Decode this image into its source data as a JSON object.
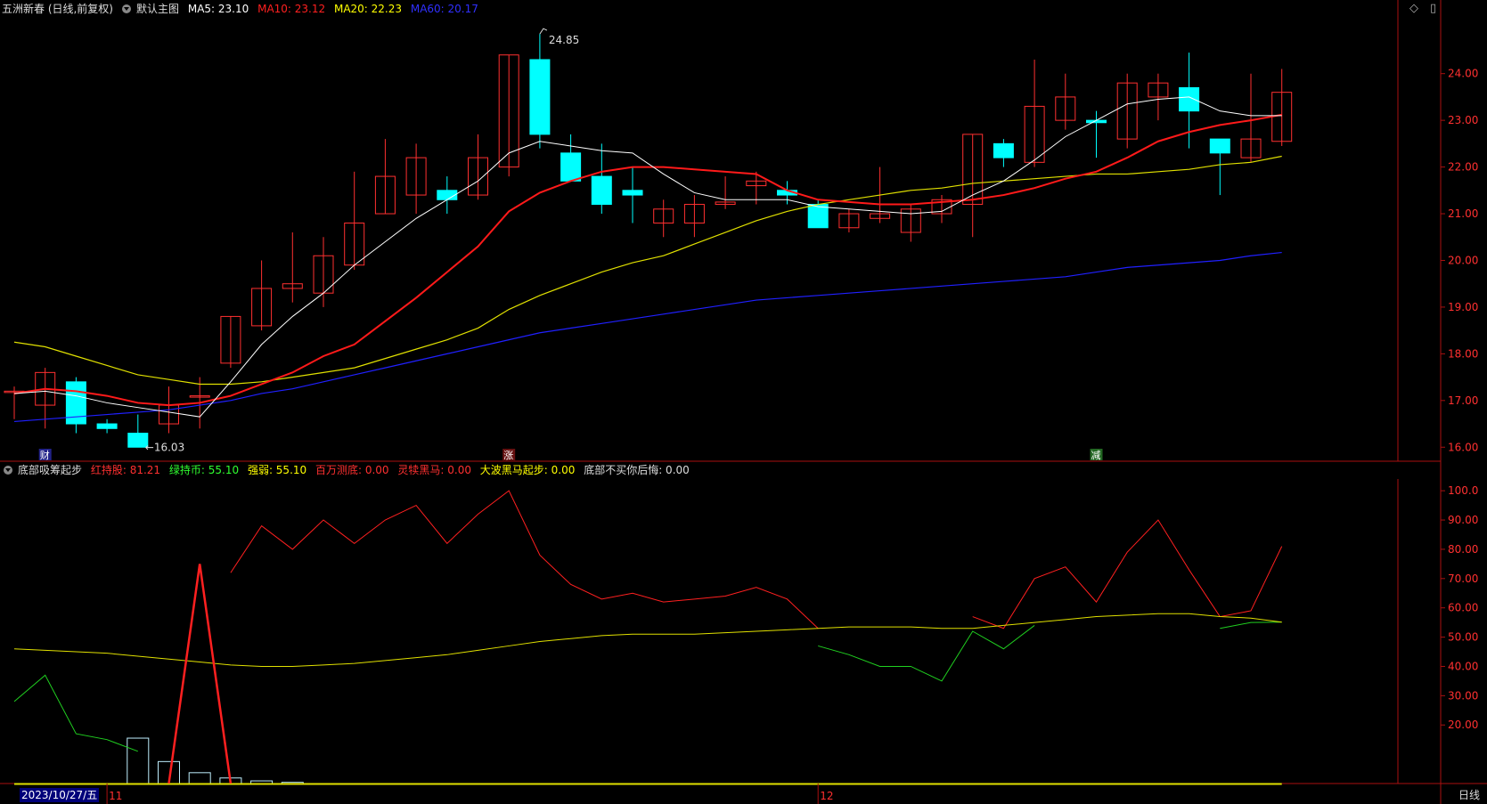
{
  "header": {
    "stock_title": "五洲新春 (日线,前复权)",
    "main_indicator": "默认主图",
    "ma": [
      {
        "label": "MA5: 23.10",
        "color": "#ffffff"
      },
      {
        "label": "MA10: 23.12",
        "color": "#ff2020"
      },
      {
        "label": "MA20: 22.23",
        "color": "#ffff00"
      },
      {
        "label": "MA60: 20.17",
        "color": "#2020ff"
      }
    ],
    "controls": [
      "◇",
      "▯"
    ]
  },
  "sub_header": {
    "indicator_name": "底部吸筹起步",
    "values": [
      {
        "label": "红持股: 81.21",
        "color": "#ff3030"
      },
      {
        "label": "绿持币: 55.10",
        "color": "#30ff30"
      },
      {
        "label": "强弱: 55.10",
        "color": "#ffff00"
      },
      {
        "label": "百万测底: 0.00",
        "color": "#ff3030"
      },
      {
        "label": "灵犊黑马: 0.00",
        "color": "#ff3030"
      },
      {
        "label": "大波黑马起步: 0.00",
        "color": "#ffff00"
      },
      {
        "label": "底部不买你后悔: 0.00",
        "color": "#dddddd"
      }
    ]
  },
  "colors": {
    "up": "#ff3030",
    "down": "#00ffff",
    "ma5": "#ffffff",
    "ma10": "#ff1a1a",
    "ma20": "#e0e000",
    "ma60": "#2020ff",
    "axis": "#aa1010",
    "label": "#ff3030"
  },
  "chart_data": [
    {
      "type": "candlestick",
      "y_ticks": [
        "24.00",
        "23.00",
        "22.00",
        "21.00",
        "20.00",
        "19.00",
        "18.00",
        "17.00",
        "16.00"
      ],
      "ylim": [
        15.7,
        25.1
      ],
      "candles": [
        {
          "o": 17.2,
          "h": 17.3,
          "l": 16.6,
          "c": 17.2
        },
        {
          "o": 16.9,
          "h": 17.7,
          "l": 16.4,
          "c": 17.6
        },
        {
          "o": 17.4,
          "h": 17.5,
          "l": 16.3,
          "c": 16.5
        },
        {
          "o": 16.5,
          "h": 16.6,
          "l": 16.3,
          "c": 16.4
        },
        {
          "o": 16.3,
          "h": 16.7,
          "l": 16.0,
          "c": 16.0
        },
        {
          "o": 16.5,
          "h": 17.3,
          "l": 16.3,
          "c": 16.9
        },
        {
          "o": 17.1,
          "h": 17.5,
          "l": 16.4,
          "c": 17.1
        },
        {
          "o": 17.8,
          "h": 18.8,
          "l": 17.7,
          "c": 18.8
        },
        {
          "o": 18.6,
          "h": 20.0,
          "l": 18.5,
          "c": 19.4
        },
        {
          "o": 19.4,
          "h": 20.6,
          "l": 19.1,
          "c": 19.5
        },
        {
          "o": 19.3,
          "h": 20.5,
          "l": 19.0,
          "c": 20.1
        },
        {
          "o": 19.9,
          "h": 21.9,
          "l": 19.8,
          "c": 20.8
        },
        {
          "o": 21.0,
          "h": 22.6,
          "l": 21.0,
          "c": 21.8
        },
        {
          "o": 21.4,
          "h": 22.5,
          "l": 21.0,
          "c": 22.2
        },
        {
          "o": 21.5,
          "h": 21.8,
          "l": 21.0,
          "c": 21.3
        },
        {
          "o": 21.4,
          "h": 22.7,
          "l": 21.3,
          "c": 22.2
        },
        {
          "o": 22.0,
          "h": 24.4,
          "l": 21.8,
          "c": 24.4
        },
        {
          "o": 24.3,
          "h": 24.85,
          "l": 22.4,
          "c": 22.7
        },
        {
          "o": 22.3,
          "h": 22.7,
          "l": 21.7,
          "c": 21.7
        },
        {
          "o": 21.8,
          "h": 22.5,
          "l": 21.0,
          "c": 21.2
        },
        {
          "o": 21.5,
          "h": 22.0,
          "l": 20.8,
          "c": 21.4
        },
        {
          "o": 20.8,
          "h": 21.3,
          "l": 20.5,
          "c": 21.1
        },
        {
          "o": 20.8,
          "h": 21.4,
          "l": 20.5,
          "c": 21.2
        },
        {
          "o": 21.2,
          "h": 21.8,
          "l": 21.1,
          "c": 21.25
        },
        {
          "o": 21.6,
          "h": 21.9,
          "l": 21.2,
          "c": 21.7
        },
        {
          "o": 21.5,
          "h": 21.7,
          "l": 21.2,
          "c": 21.4
        },
        {
          "o": 21.2,
          "h": 21.3,
          "l": 20.7,
          "c": 20.7
        },
        {
          "o": 20.7,
          "h": 21.1,
          "l": 20.6,
          "c": 21.0
        },
        {
          "o": 20.9,
          "h": 22.0,
          "l": 20.8,
          "c": 21.0
        },
        {
          "o": 20.6,
          "h": 21.2,
          "l": 20.4,
          "c": 21.1
        },
        {
          "o": 21.0,
          "h": 21.4,
          "l": 20.8,
          "c": 21.3
        },
        {
          "o": 21.2,
          "h": 22.7,
          "l": 20.5,
          "c": 22.7
        },
        {
          "o": 22.5,
          "h": 22.6,
          "l": 22.0,
          "c": 22.2
        },
        {
          "o": 22.1,
          "h": 24.3,
          "l": 22.0,
          "c": 23.3
        },
        {
          "o": 23.0,
          "h": 24.0,
          "l": 22.8,
          "c": 23.5
        },
        {
          "o": 23.0,
          "h": 23.2,
          "l": 22.2,
          "c": 22.95
        },
        {
          "o": 22.6,
          "h": 24.0,
          "l": 22.4,
          "c": 23.8
        },
        {
          "o": 23.5,
          "h": 24.0,
          "l": 23.0,
          "c": 23.8
        },
        {
          "o": 23.7,
          "h": 24.45,
          "l": 22.4,
          "c": 23.2
        },
        {
          "o": 22.6,
          "h": 22.6,
          "l": 21.4,
          "c": 22.3
        },
        {
          "o": 22.2,
          "h": 24.0,
          "l": 22.1,
          "c": 22.6
        },
        {
          "o": 22.55,
          "h": 24.1,
          "l": 22.45,
          "c": 23.6
        }
      ],
      "ma5": [
        17.15,
        17.2,
        17.1,
        16.95,
        16.85,
        16.75,
        16.65,
        17.4,
        18.2,
        18.8,
        19.3,
        19.9,
        20.4,
        20.9,
        21.3,
        21.7,
        22.3,
        22.55,
        22.45,
        22.35,
        22.3,
        21.85,
        21.45,
        21.3,
        21.3,
        21.3,
        21.15,
        21.1,
        21.05,
        21.0,
        21.05,
        21.4,
        21.7,
        22.15,
        22.65,
        23.0,
        23.35,
        23.45,
        23.5,
        23.2,
        23.1,
        23.1
      ],
      "ma10": [
        17.15,
        17.25,
        17.2,
        17.1,
        16.95,
        16.9,
        16.95,
        17.1,
        17.35,
        17.6,
        17.95,
        18.2,
        18.7,
        19.2,
        19.75,
        20.3,
        21.05,
        21.45,
        21.7,
        21.9,
        22.0,
        22.0,
        21.95,
        21.9,
        21.85,
        21.5,
        21.3,
        21.25,
        21.2,
        21.2,
        21.25,
        21.3,
        21.4,
        21.55,
        21.75,
        21.9,
        22.2,
        22.55,
        22.75,
        22.9,
        23.0,
        23.12
      ],
      "ma20": [
        18.25,
        18.15,
        17.95,
        17.75,
        17.55,
        17.45,
        17.35,
        17.35,
        17.4,
        17.5,
        17.6,
        17.7,
        17.9,
        18.1,
        18.3,
        18.55,
        18.95,
        19.25,
        19.5,
        19.75,
        19.95,
        20.1,
        20.35,
        20.6,
        20.85,
        21.05,
        21.2,
        21.3,
        21.4,
        21.5,
        21.55,
        21.65,
        21.7,
        21.75,
        21.8,
        21.85,
        21.85,
        21.9,
        21.95,
        22.05,
        22.1,
        22.23
      ],
      "ma60": [
        16.55,
        16.6,
        16.65,
        16.7,
        16.75,
        16.8,
        16.9,
        17.0,
        17.15,
        17.25,
        17.4,
        17.55,
        17.7,
        17.85,
        18.0,
        18.15,
        18.3,
        18.45,
        18.55,
        18.65,
        18.75,
        18.85,
        18.95,
        19.05,
        19.15,
        19.2,
        19.25,
        19.3,
        19.35,
        19.4,
        19.45,
        19.5,
        19.55,
        19.6,
        19.65,
        19.75,
        19.85,
        19.9,
        19.95,
        20.0,
        20.1,
        20.17
      ],
      "annotations": [
        {
          "label": "24.85",
          "index": 17,
          "value": 24.85,
          "kind": "high"
        },
        {
          "label": "←16.03",
          "index": 4,
          "value": 16.03,
          "kind": "low"
        }
      ],
      "markers": [
        {
          "text": "财",
          "index": 1,
          "bg": "#222288"
        },
        {
          "text": "涨",
          "index": 16,
          "bg": "#661111"
        },
        {
          "text": "减",
          "index": 35,
          "bg": "#226622"
        }
      ]
    },
    {
      "type": "line",
      "y_ticks": [
        "100.0",
        "90.00",
        "80.00",
        "70.00",
        "60.00",
        "50.00",
        "40.00",
        "30.00",
        "20.00"
      ],
      "ylim": [
        0,
        104
      ],
      "series": [
        {
          "name": "红持股",
          "color": "#ff2020",
          "values": [
            null,
            null,
            null,
            null,
            null,
            null,
            null,
            72,
            88,
            80,
            90,
            82,
            90,
            95,
            82,
            92,
            100,
            78,
            68,
            63,
            65,
            62,
            63,
            64,
            67,
            63,
            53,
            null,
            null,
            null,
            null,
            57,
            53,
            70,
            74,
            62,
            79,
            90,
            73,
            57,
            59,
            81
          ]
        },
        {
          "name": "绿持币",
          "color": "#20d020",
          "values": [
            28,
            37,
            17,
            15,
            11,
            null,
            null,
            null,
            null,
            null,
            null,
            null,
            null,
            null,
            null,
            null,
            null,
            null,
            null,
            null,
            null,
            null,
            null,
            null,
            null,
            null,
            47,
            44,
            40,
            40,
            35,
            52,
            46,
            54,
            null,
            null,
            null,
            null,
            null,
            53,
            55,
            55.1
          ]
        },
        {
          "name": "强弱",
          "color": "#e0e000",
          "values": [
            46,
            45.5,
            45,
            44.5,
            43.5,
            42.5,
            41.5,
            40.5,
            40,
            40,
            40.5,
            41,
            42,
            43,
            44,
            45.5,
            47,
            48.5,
            49.5,
            50.5,
            51,
            51,
            51,
            51.5,
            52,
            52.5,
            53,
            53.5,
            53.5,
            53.5,
            53,
            53,
            54,
            55,
            56,
            57,
            57.5,
            58,
            58,
            57,
            56.5,
            55.1
          ]
        },
        {
          "name": "百万测底",
          "color": "#ff2020",
          "values": [
            0,
            0,
            0,
            0,
            0,
            0,
            75,
            0,
            0,
            0,
            0,
            0,
            0,
            0,
            0,
            0,
            0,
            0,
            0,
            0,
            0,
            0,
            0,
            0,
            0,
            0,
            0,
            0,
            0,
            0,
            0,
            0,
            0,
            0,
            0,
            0,
            0,
            0,
            0,
            0,
            0,
            0
          ]
        }
      ],
      "bars": [
        0,
        0,
        0,
        0,
        15.5,
        7.5,
        3.7,
        1.9,
        0.9,
        0.4,
        0,
        0,
        0,
        0,
        0,
        0,
        0,
        0,
        0,
        0,
        0,
        0,
        0,
        0,
        0,
        0,
        0,
        0,
        0,
        0,
        0,
        0,
        0,
        0,
        0,
        0,
        0,
        0,
        0,
        0,
        0,
        0
      ]
    }
  ],
  "footer": {
    "date": "2023/10/27/五",
    "month_labels": [
      {
        "text": "11",
        "index": 3
      },
      {
        "text": "12",
        "index": 26
      }
    ],
    "period": "日线"
  }
}
